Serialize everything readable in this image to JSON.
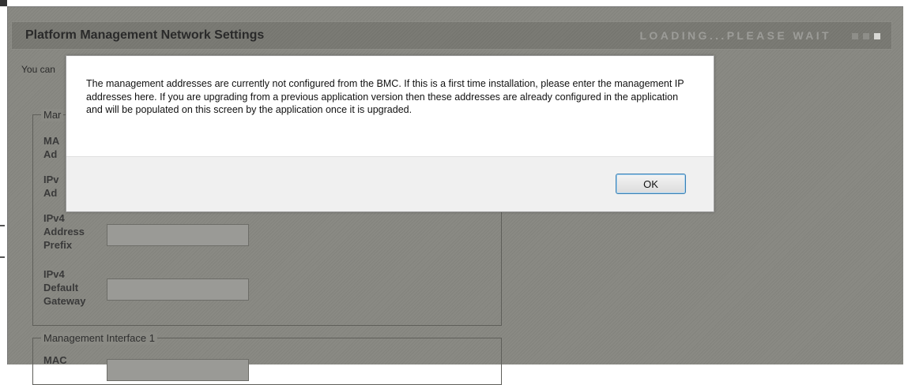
{
  "panel": {
    "title": "Platform Management Network Settings",
    "loading_text": "LOADING...PLEASE WAIT",
    "intro_text": "You can",
    "fieldsets": [
      {
        "legend": "Mar",
        "fields": [
          {
            "label": "MA\nAd",
            "value": ""
          },
          {
            "label": "IPv\nAd",
            "value": ""
          },
          {
            "label": "IPv4\nAddress\nPrefix",
            "value": ""
          },
          {
            "label": "IPv4\nDefault\nGateway",
            "value": ""
          }
        ]
      },
      {
        "legend": "Management Interface 1",
        "fields": [
          {
            "label": "MAC",
            "value": ""
          }
        ]
      }
    ]
  },
  "dialog": {
    "message": "The management addresses are currently not configured from the BMC.  If this is a first time installation, please enter the management IP addresses here.  If you are upgrading from a previous application version then these addresses are already configured in the application and will be populated on this screen by the application once it is upgraded.",
    "ok_label": "OK"
  }
}
